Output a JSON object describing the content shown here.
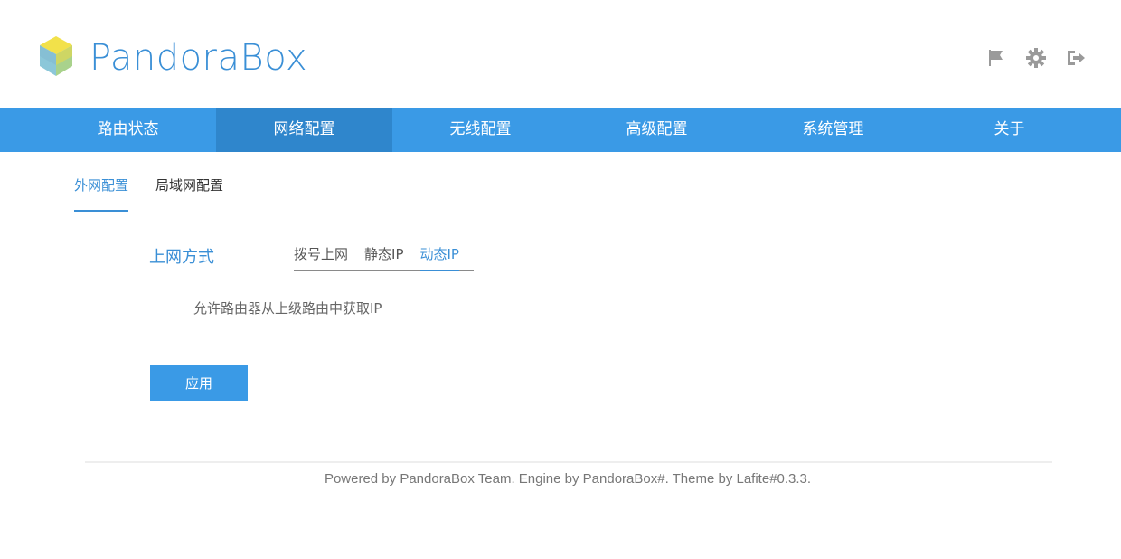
{
  "brand": {
    "name": "PandoraBox",
    "color": "#3a8fd6"
  },
  "header_icons": [
    "flag-icon",
    "gear-icon",
    "logout-icon"
  ],
  "nav": {
    "items": [
      {
        "label": "路由状态"
      },
      {
        "label": "网络配置",
        "active": true
      },
      {
        "label": "无线配置"
      },
      {
        "label": "高级配置"
      },
      {
        "label": "系统管理"
      },
      {
        "label": "关于"
      }
    ],
    "color": "#3a9ae6",
    "active_color": "#2f86cc"
  },
  "subtabs": [
    {
      "label": "外网配置",
      "active": true
    },
    {
      "label": "局域网配置"
    }
  ],
  "form": {
    "label": "上网方式",
    "modes": [
      {
        "label": "拨号上网"
      },
      {
        "label": "静态IP"
      },
      {
        "label": "动态IP",
        "active": true
      }
    ],
    "description": "允许路由器从上级路由中获取IP",
    "apply_label": "应用"
  },
  "footer": {
    "text": "Powered by PandoraBox Team. Engine by PandoraBox#. Theme by Lafite#0.3.3."
  }
}
